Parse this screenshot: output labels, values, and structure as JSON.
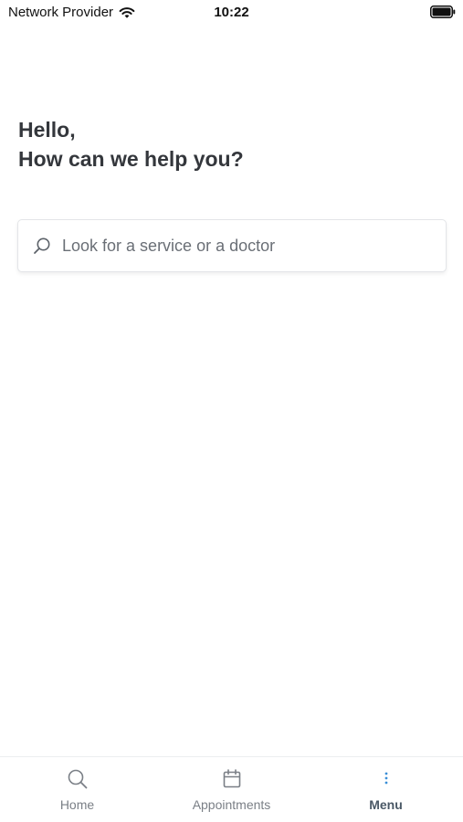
{
  "status_bar": {
    "carrier": "Network Provider",
    "time": "10:22",
    "icons": [
      "wifi-icon",
      "battery-icon"
    ]
  },
  "greeting": {
    "line1": "Hello,",
    "line2": "How can we help you?"
  },
  "search": {
    "placeholder": "Look for a service or a doctor",
    "value": "",
    "icon": "search-icon"
  },
  "tab_bar": {
    "tabs": [
      {
        "label": "Home",
        "icon": "search-icon",
        "active": false
      },
      {
        "label": "Appointments",
        "icon": "calendar-icon",
        "active": false
      },
      {
        "label": "Menu",
        "icon": "more-vertical-icon",
        "active": true
      }
    ]
  },
  "colors": {
    "text_primary": "#34373c",
    "text_secondary": "#7a7f86",
    "active_tab_label": "#4a5866",
    "active_tab_icon": "#3a8fd8",
    "border": "#e3e5e8"
  }
}
